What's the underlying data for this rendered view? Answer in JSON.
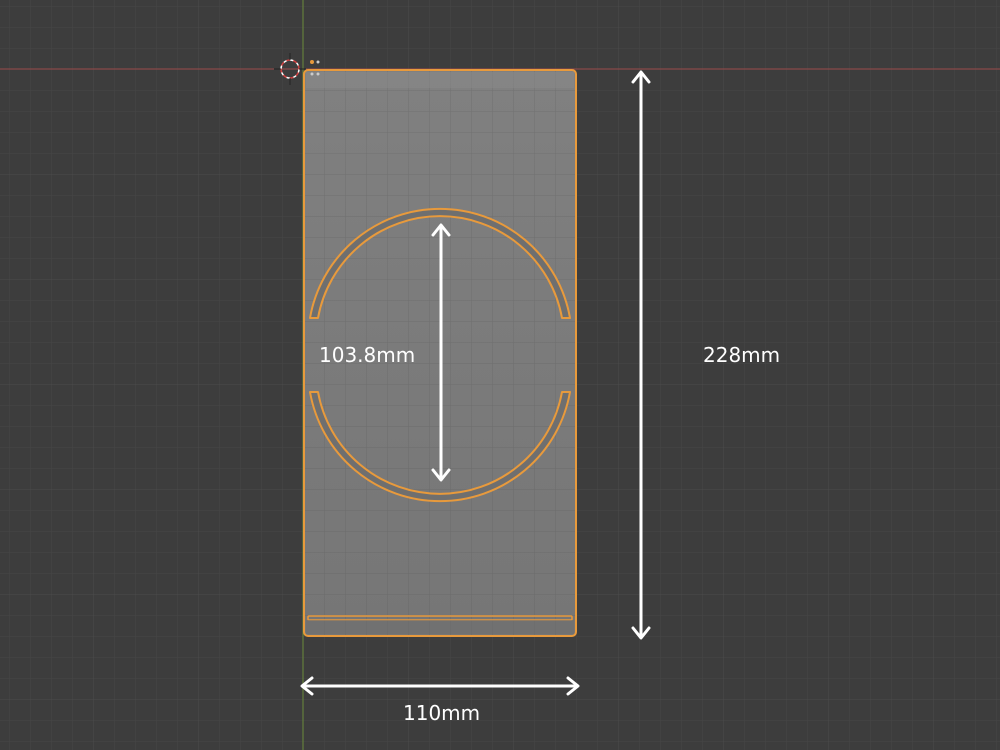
{
  "viewport": {
    "background": "#3d3d3d",
    "grid_minor": "#454545",
    "grid_major": "#4a4a4a",
    "x_axis_color": "#a04848",
    "y_axis_color": "#6b8f3a",
    "selection_outline": "#e89a3c",
    "object_fill": "#7a7a7a"
  },
  "dimensions": {
    "height_label": "228mm",
    "width_label": "110mm",
    "circle_label": "103.8mm"
  },
  "icons": {
    "cursor": "3d-cursor-icon",
    "origin": "object-origin-icon"
  }
}
